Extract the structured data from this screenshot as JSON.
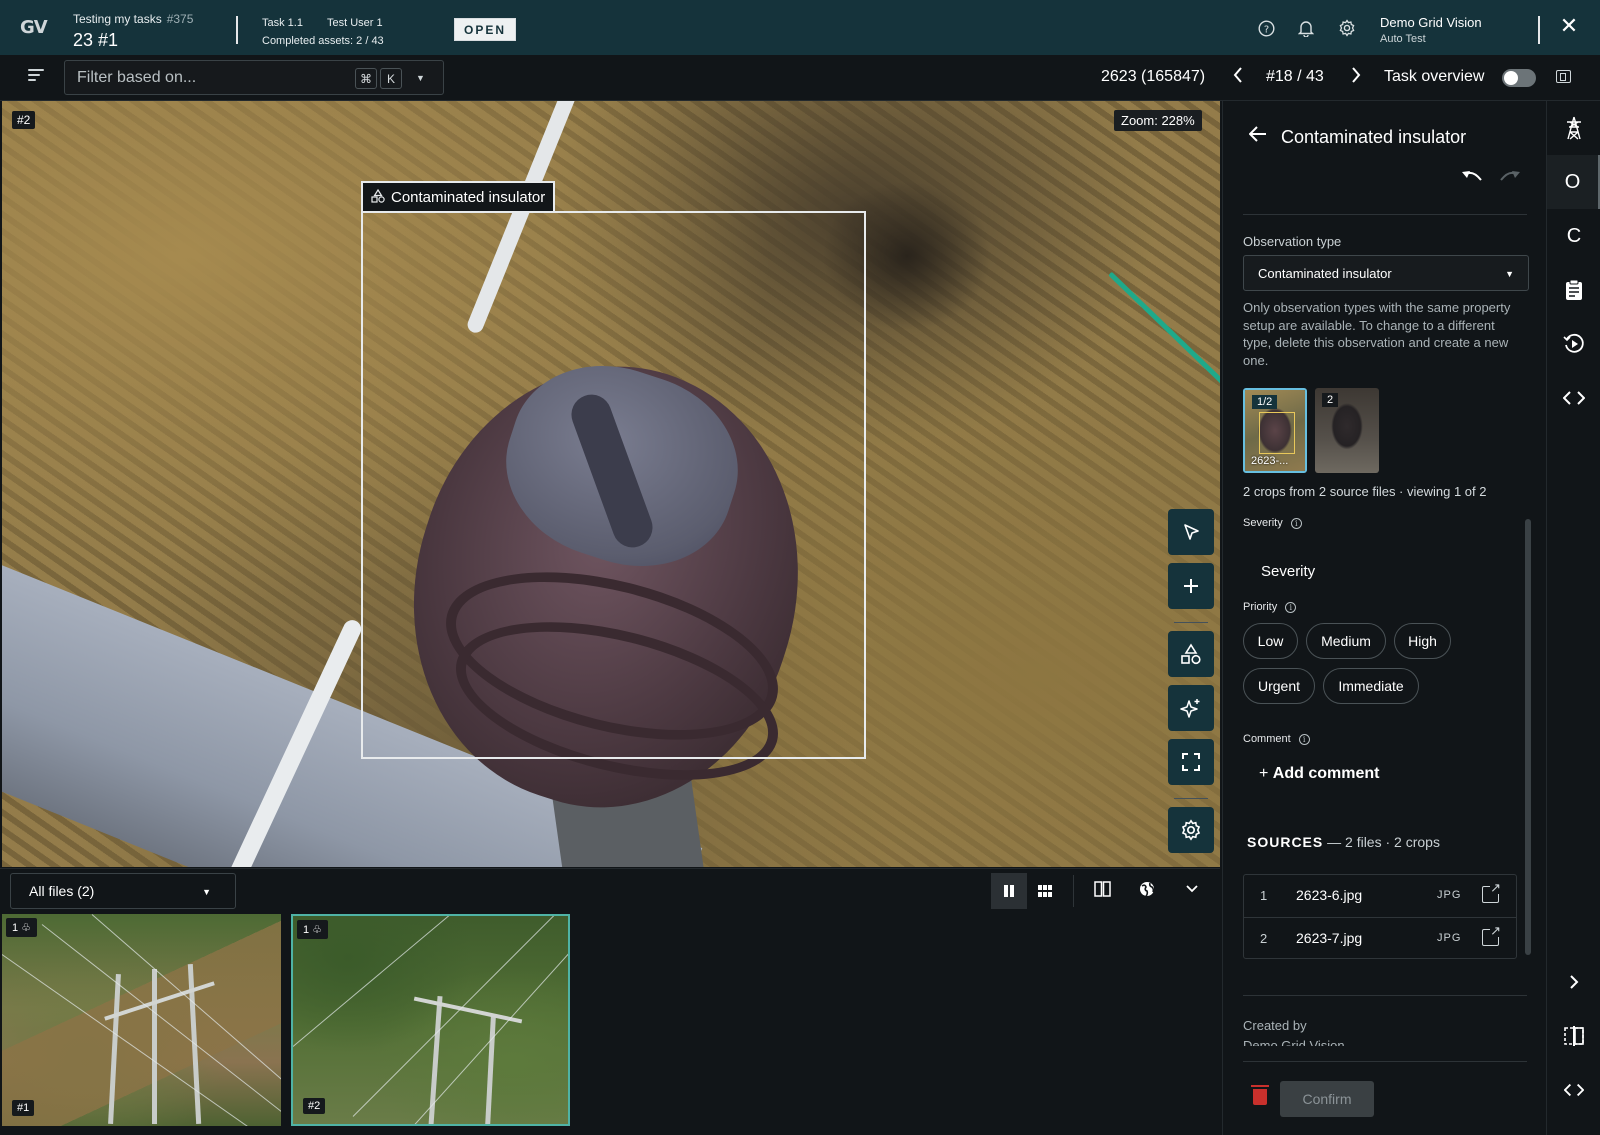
{
  "header": {
    "logo": "GV",
    "task_name": "Testing my tasks",
    "task_id": "#375",
    "task_numbers": "23  #1",
    "task_version": "Task 1.1",
    "assignee": "Test User 1",
    "completed_assets": "Completed assets: 2 / 43",
    "status": "OPEN",
    "user_name": "Demo Grid Vision",
    "user_org": "Auto Test",
    "icons": [
      "help-icon",
      "bell-icon",
      "gear-icon",
      "close-icon"
    ]
  },
  "toolbar": {
    "filter_placeholder": "Filter based on...",
    "shortcut_cmd": "⌘",
    "shortcut_key": "K",
    "asset_id": "2623 (165847)",
    "asset_position": "#18 / 43",
    "task_overview_label": "Task overview",
    "task_overview_on": false
  },
  "viewer": {
    "image_tag": "#2",
    "zoom": "Zoom: 228%",
    "annotation_label": "Contaminated insulator",
    "tools": [
      "pointer-icon",
      "plus-icon",
      "shapes-icon",
      "sparkle-icon",
      "fullscreen-icon",
      "settings-icon"
    ]
  },
  "files_bar": {
    "selector": "All files (2)"
  },
  "thumbnails": [
    {
      "count": "1",
      "number": "#1",
      "selected": false
    },
    {
      "count": "1",
      "number": "#2",
      "selected": true
    }
  ],
  "panel": {
    "title": "Contaminated insulator",
    "observation_type_label": "Observation type",
    "observation_type_value": "Contaminated insulator",
    "observation_help": "Only observation types with the same property setup are available. To change to a different type, delete this observation and create a new one.",
    "crops": [
      {
        "badge": "1/2",
        "name": "2623-...",
        "selected": true
      },
      {
        "badge": "2",
        "name": "",
        "selected": false
      }
    ],
    "crops_summary": "2 crops from 2 source files · viewing 1 of 2",
    "severity_label": "Severity",
    "severity_value": "Severity",
    "priority_label": "Priority",
    "priorities": [
      "Low",
      "Medium",
      "High",
      "Urgent",
      "Immediate"
    ],
    "comment_label": "Comment",
    "add_comment": "Add comment",
    "sources_title": "SOURCES",
    "sources_meta": "— 2 files · 2 crops",
    "sources": [
      {
        "n": "1",
        "file": "2623-6.jpg",
        "type": "JPG"
      },
      {
        "n": "2",
        "file": "2623-7.jpg",
        "type": "JPG"
      }
    ],
    "created_by_label": "Created by",
    "created_by_value": "Demo Grid Vision",
    "confirm": "Confirm"
  },
  "rail": {
    "items": [
      "tower-icon",
      "O",
      "C",
      "clipboard-icon",
      "play-history-icon",
      "code-icon"
    ],
    "bottom": [
      "chevron-right-icon",
      "split-view-icon",
      "code-icon"
    ]
  }
}
